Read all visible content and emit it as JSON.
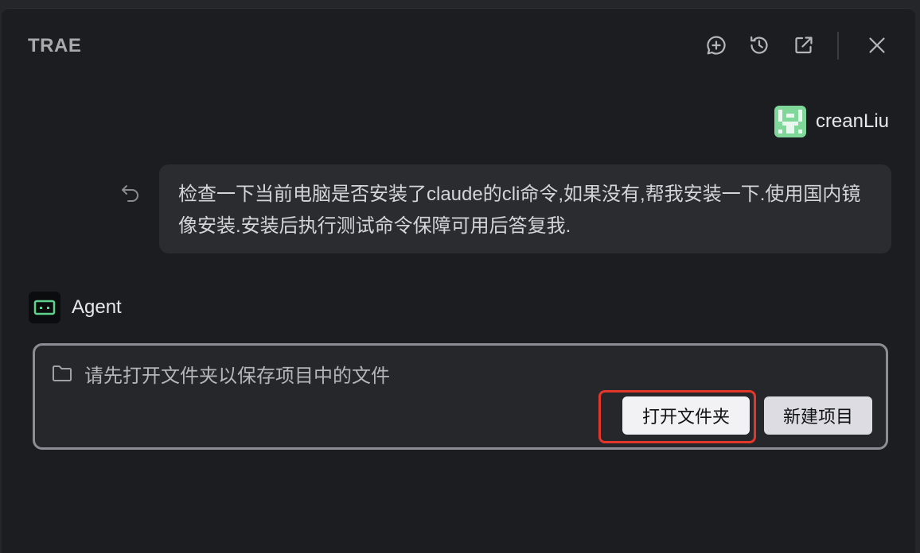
{
  "header": {
    "title": "TRAE"
  },
  "user": {
    "name": "creanLiu"
  },
  "message": {
    "text": "检查一下当前电脑是否安装了claude的cli命令,如果没有,帮我安装一下.使用国内镜像安装.安装后执行测试命令保障可用后答复我."
  },
  "agent": {
    "name": "Agent"
  },
  "folder_prompt": {
    "text": "请先打开文件夹以保存项目中的文件",
    "open_folder_label": "打开文件夹",
    "new_project_label": "新建项目"
  },
  "colors": {
    "panel_bg": "#1c1d20",
    "bubble_bg": "#2b2c30",
    "highlight": "#e4372b",
    "avatar_green": "#7fd89a",
    "agent_icon_green": "#5fd38d"
  },
  "icons": [
    "new-chat-icon",
    "history-icon",
    "open-external-icon",
    "close-icon",
    "undo-icon",
    "folder-icon",
    "agent-icon"
  ]
}
